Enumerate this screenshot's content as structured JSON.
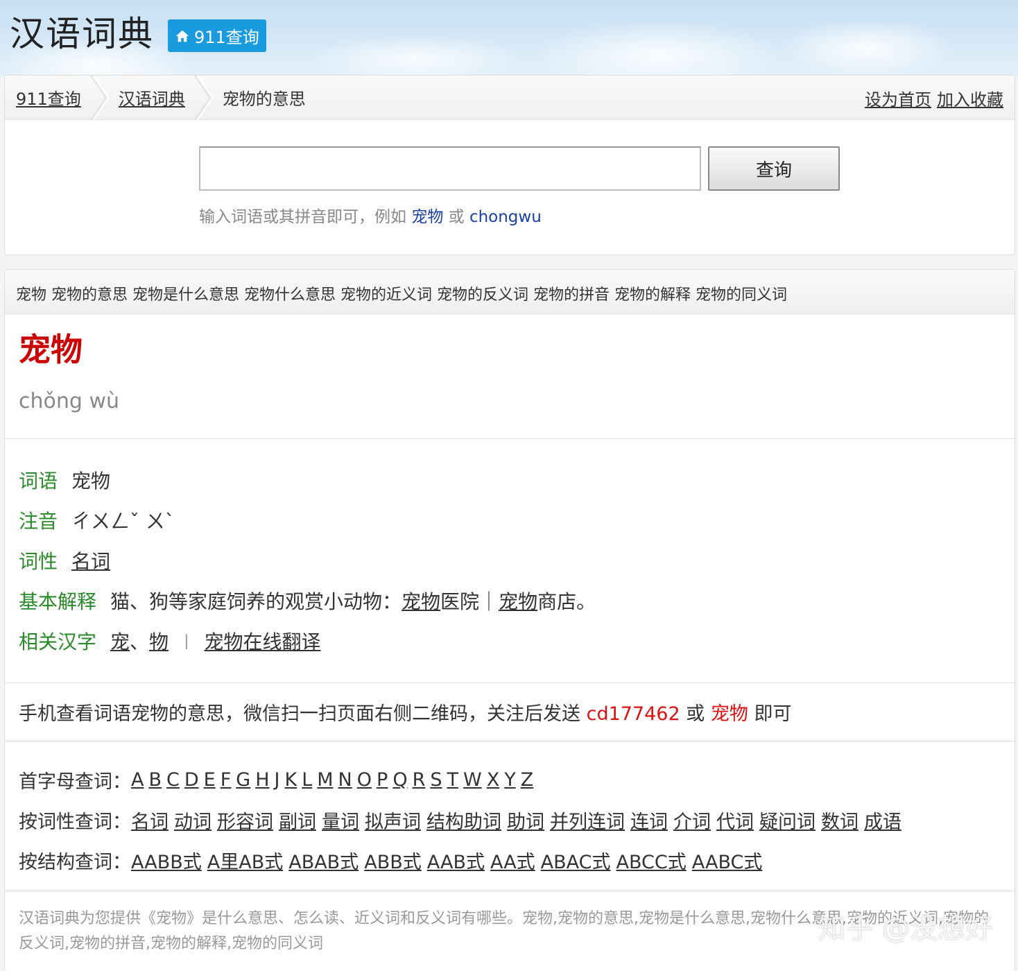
{
  "header": {
    "title": "汉语词典",
    "home_badge": "911查询"
  },
  "breadcrumb": {
    "items": [
      "911查询",
      "汉语词典",
      "宠物的意思"
    ],
    "set_home": "设为首页",
    "add_favorite": "加入收藏"
  },
  "search": {
    "value": "",
    "button": "查询",
    "hint_prefix": "输入词语或其拼音即可，例如",
    "hint_example1": "宠物",
    "hint_or": "或",
    "hint_example2": "chongwu"
  },
  "tagline": "宠物 宠物的意思 宠物是什么意思 宠物什么意思 宠物的近义词 宠物的反义词 宠物的拼音 宠物的解释 宠物的同义词",
  "word": {
    "title": "宠物",
    "pinyin": "chǒng wù"
  },
  "details": {
    "ciyu_label": "词语",
    "ciyu_value": "宠物",
    "zhuyin_label": "注音",
    "zhuyin_value": "ㄔㄨㄥˇ ㄨˋ",
    "cixing_label": "词性",
    "cixing_value": "名词",
    "jiben_label": "基本解释",
    "jiben_text": "猫、狗等家庭饲养的观赏小动物：",
    "jiben_link1": "宠物",
    "jiben_text2": "医院｜",
    "jiben_link2": "宠物",
    "jiben_text3": "商店。",
    "related_label": "相关汉字",
    "related_char1": "宠",
    "related_sep": "、",
    "related_char2": "物",
    "related_pipe": "|",
    "translate_link": "宠物在线翻译"
  },
  "wechat": {
    "text1": "手机查看词语宠物的意思，微信扫一扫页面右侧二维码，关注后发送",
    "code": "cd177462",
    "or": "或",
    "word": "宠物",
    "text2": "即可"
  },
  "lookup": {
    "letters_label": "首字母查词：",
    "letters": [
      "A",
      "B",
      "C",
      "D",
      "E",
      "F",
      "G",
      "H",
      "J",
      "K",
      "L",
      "M",
      "N",
      "O",
      "P",
      "Q",
      "R",
      "S",
      "T",
      "W",
      "X",
      "Y",
      "Z"
    ],
    "pos_label": "按词性查词：",
    "pos": [
      "名词",
      "动词",
      "形容词",
      "副词",
      "量词",
      "拟声词",
      "结构助词",
      "助词",
      "并列连词",
      "连词",
      "介词",
      "代词",
      "疑问词",
      "数词",
      "成语"
    ],
    "struct_label": "按结构查词：",
    "struct": [
      "AABB式",
      "A里AB式",
      "ABAB式",
      "ABB式",
      "AAB式",
      "AA式",
      "ABAC式",
      "ABCC式",
      "AABC式"
    ]
  },
  "footer": "汉语词典为您提供《宠物》是什么意思、怎么读、近义词和反义词有哪些。宠物,宠物的意思,宠物是什么意思,宠物什么意思,宠物的近义词,宠物的反义词,宠物的拼音,宠物的解释,宠物的同义词",
  "watermark": "知乎 @没想好"
}
